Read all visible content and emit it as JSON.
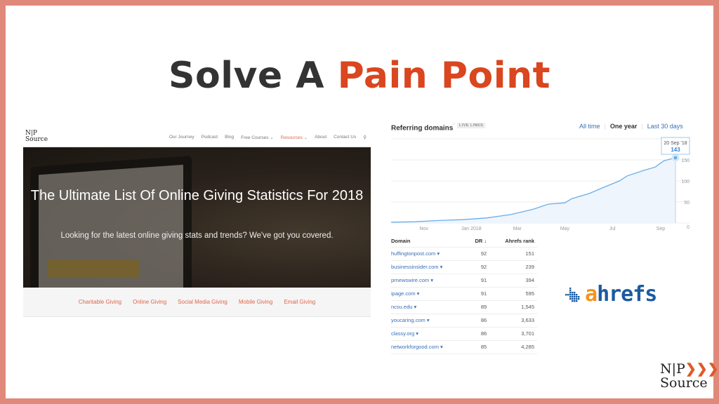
{
  "slide": {
    "title_part1": "Solve A",
    "title_part2": "Pain Point",
    "border_color": "#e0897a",
    "accent": "#d9461f"
  },
  "site": {
    "logo": {
      "line1": "N|P",
      "line2": "Source"
    },
    "nav": [
      "Our Journey",
      "Podcast",
      "Blog",
      "Free Courses ⌄",
      "Resources ⌄",
      "About",
      "Contact Us"
    ],
    "active_nav": "Resources ⌄",
    "search_icon": "search-icon",
    "hero_title": "The Ultimate List Of Online Giving Statistics For 2018",
    "hero_subtitle": "Looking for the latest online giving stats and trends? We've got you covered.",
    "categories": [
      "Charitable Giving",
      "Online Giving",
      "Social Media Giving",
      "Mobile Giving",
      "Email Giving"
    ]
  },
  "ahrefs": {
    "title": "Referring domains",
    "info": "ⁱ",
    "badge": "LIVE LINKS",
    "ranges": [
      "All time",
      "One year",
      "Last 30 days"
    ],
    "selected_range": "One year",
    "logo_text": "ahrefs",
    "table": {
      "headers": [
        "Domain",
        "DR ↓",
        "Ahrefs rank"
      ],
      "rows": [
        [
          "huffingtonpost.com ▾",
          "92",
          "151"
        ],
        [
          "businessinsider.com ▾",
          "92",
          "239"
        ],
        [
          "prnewswire.com ▾",
          "91",
          "394"
        ],
        [
          "ipage.com ▾",
          "91",
          "595"
        ],
        [
          "ncsu.edu ▾",
          "89",
          "1,545"
        ],
        [
          "youcaring.com ▾",
          "86",
          "3,633"
        ],
        [
          "classy.org ▾",
          "86",
          "3,701"
        ],
        [
          "networkforgood.com ▾",
          "85",
          "4,285"
        ]
      ]
    }
  },
  "chart_data": {
    "type": "area",
    "title": "Referring domains",
    "x_ticks": [
      "Nov",
      "Jan 2018",
      "Mar",
      "May",
      "Jul",
      "Sep"
    ],
    "y_ticks": [
      "0",
      "50",
      "100",
      "150"
    ],
    "ylim": [
      0,
      200
    ],
    "xlim": [
      "2017-09-20",
      "2018-09-20"
    ],
    "grid": true,
    "color": "#6aaee8",
    "points": [
      [
        "2017-09-20",
        2
      ],
      [
        "2017-10-20",
        3
      ],
      [
        "2017-11-20",
        6
      ],
      [
        "2017-12-20",
        8
      ],
      [
        "2018-01-20",
        12
      ],
      [
        "2018-02-20",
        20
      ],
      [
        "2018-03-20",
        32
      ],
      [
        "2018-04-10",
        45
      ],
      [
        "2018-05-01",
        48
      ],
      [
        "2018-05-10",
        58
      ],
      [
        "2018-06-01",
        70
      ],
      [
        "2018-06-20",
        85
      ],
      [
        "2018-07-10",
        100
      ],
      [
        "2018-07-20",
        112
      ],
      [
        "2018-08-10",
        125
      ],
      [
        "2018-08-25",
        133
      ],
      [
        "2018-09-05",
        148
      ],
      [
        "2018-09-20",
        155
      ]
    ],
    "tooltip": {
      "date": "20 Sep '18",
      "value": "143"
    }
  }
}
